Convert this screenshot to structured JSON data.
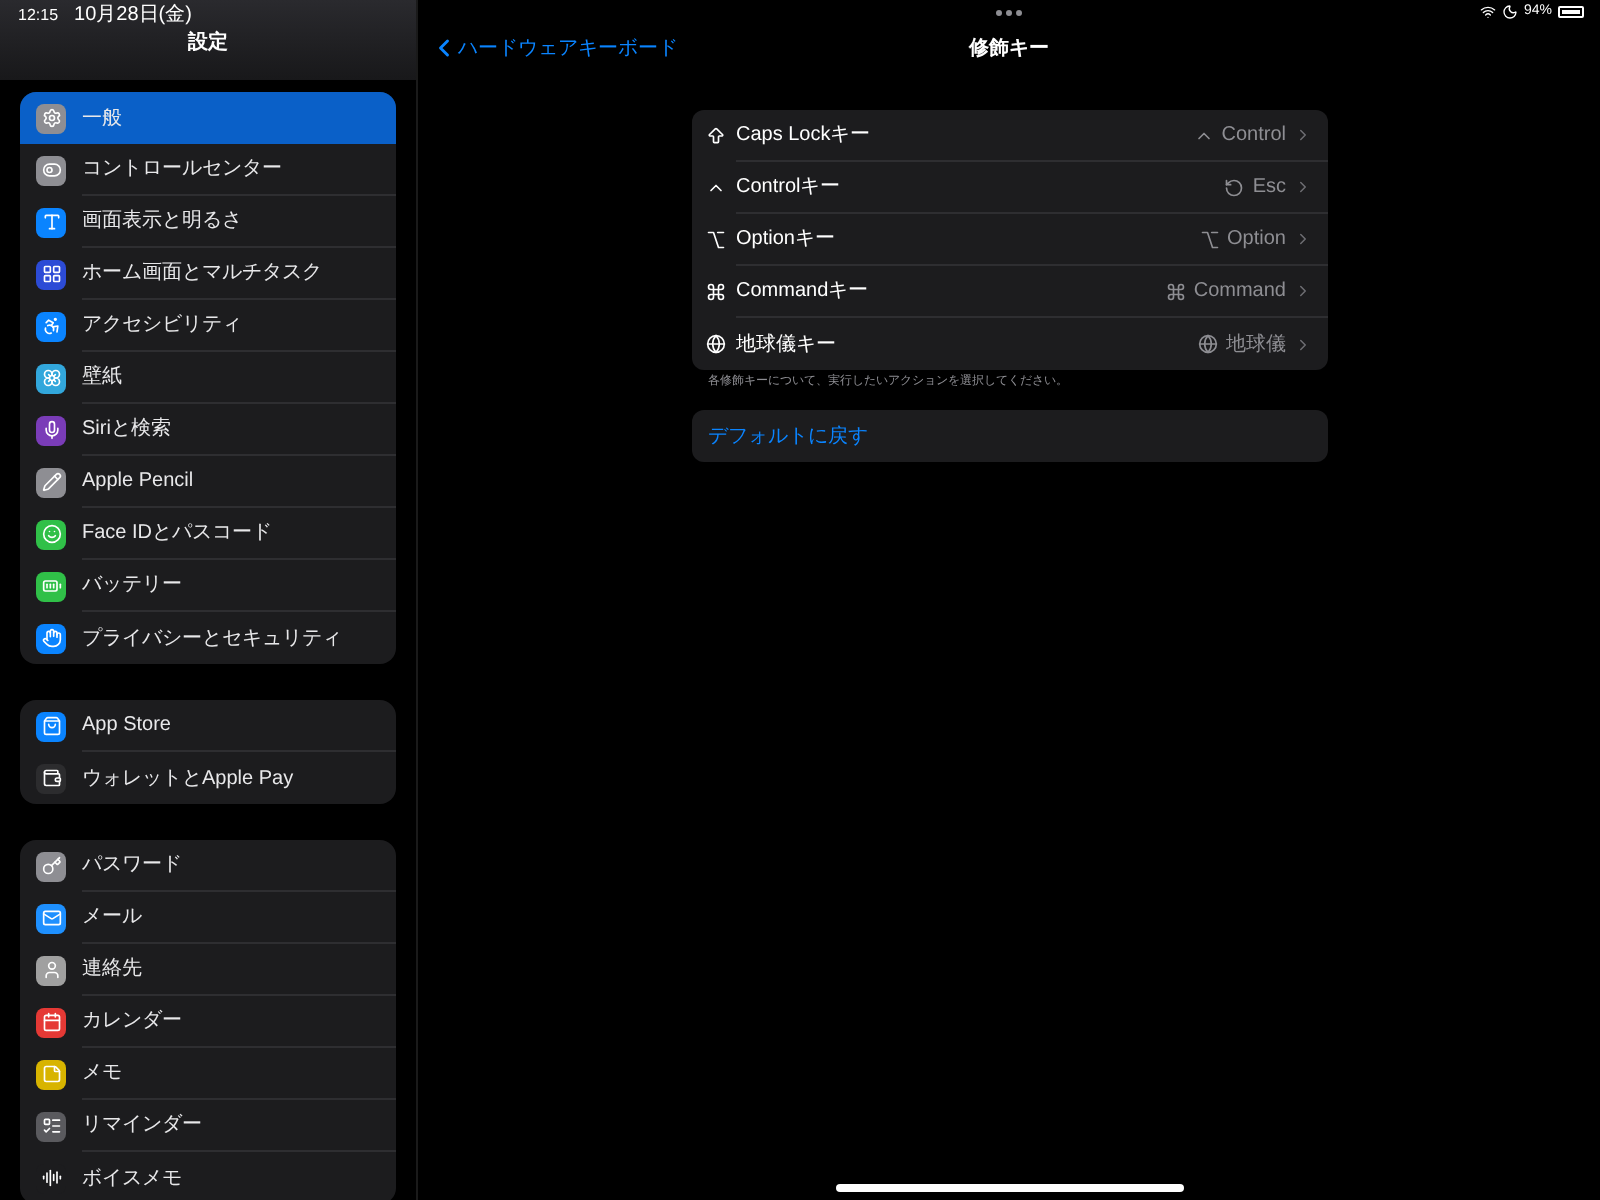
{
  "status_bar": {
    "time": "12:15",
    "date": "10月28日(金)",
    "battery": "94%"
  },
  "sidebar": {
    "title": "設定",
    "groups": [
      {
        "items": [
          {
            "label": "一般",
            "selected": true
          },
          {
            "label": "コントロールセンター",
            "selected": false
          },
          {
            "label": "画面表示と明るさ",
            "selected": false
          },
          {
            "label": "ホーム画面とマルチタスク",
            "selected": false
          },
          {
            "label": "アクセシビリティ",
            "selected": false
          },
          {
            "label": "壁紙",
            "selected": false
          },
          {
            "label": "Siriと検索",
            "selected": false
          },
          {
            "label": "Apple Pencil",
            "selected": false
          },
          {
            "label": "Face IDとパスコード",
            "selected": false
          },
          {
            "label": "バッテリー",
            "selected": false
          },
          {
            "label": "プライバシーとセキュリティ",
            "selected": false
          }
        ]
      },
      {
        "items": [
          {
            "label": "App Store",
            "selected": false
          },
          {
            "label": "ウォレットとApple Pay",
            "selected": false
          }
        ]
      },
      {
        "items": [
          {
            "label": "パスワード",
            "selected": false
          },
          {
            "label": "メール",
            "selected": false
          },
          {
            "label": "連絡先",
            "selected": false
          },
          {
            "label": "カレンダー",
            "selected": false
          },
          {
            "label": "メモ",
            "selected": false
          },
          {
            "label": "リマインダー",
            "selected": false
          },
          {
            "label": "ボイスメモ",
            "selected": false
          }
        ]
      }
    ]
  },
  "nav": {
    "back": "ハードウェアキーボード",
    "title": "修飾キー"
  },
  "modifiers": [
    {
      "label": "Caps Lockキー",
      "value": "Control"
    },
    {
      "label": "Controlキー",
      "value": "Esc"
    },
    {
      "label": "Optionキー",
      "value": "Option"
    },
    {
      "label": "Commandキー",
      "value": "Command"
    },
    {
      "label": "地球儀キー",
      "value": "地球儀"
    }
  ],
  "footnote": "各修飾キーについて、実行したいアクションを選択してください。",
  "reset_button": "デフォルトに戻す"
}
